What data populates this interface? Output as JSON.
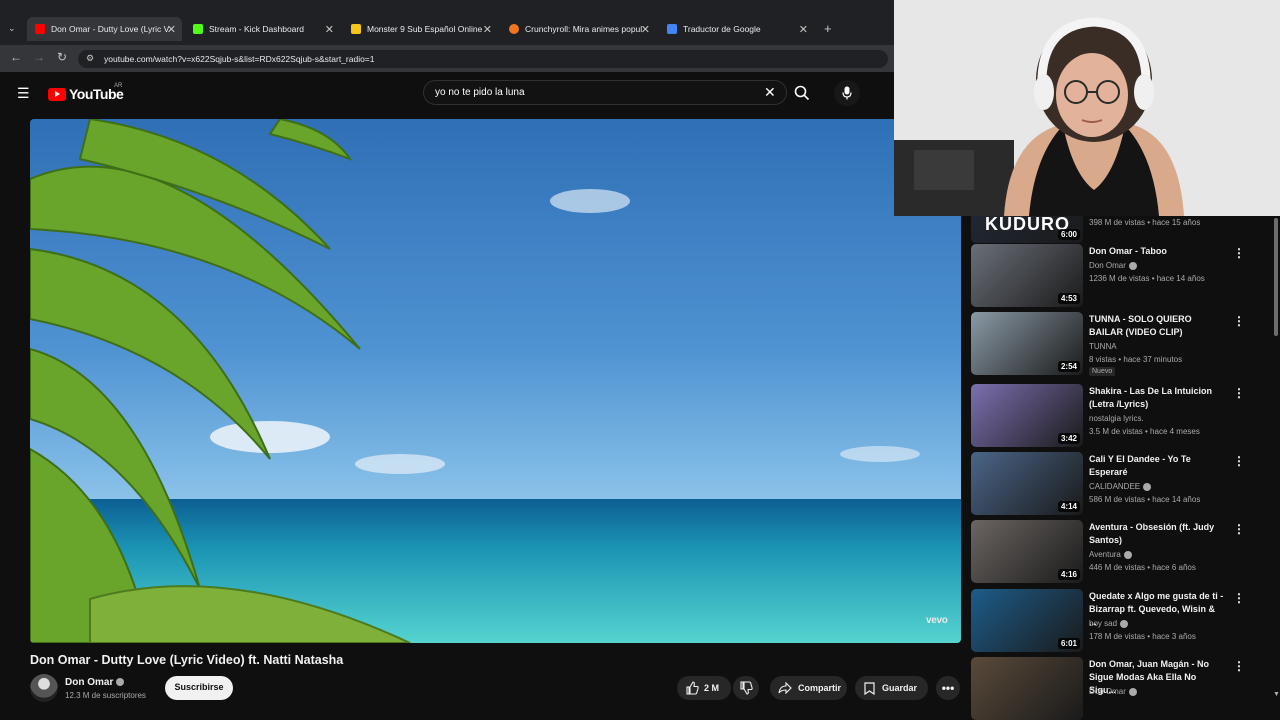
{
  "browser": {
    "tabs": [
      {
        "title": "Don Omar - Dutty Love (Lyric V",
        "favicon_color": "#ff0000",
        "active": true
      },
      {
        "title": "Stream - Kick Dashboard",
        "favicon_color": "#53fc18",
        "active": false
      },
      {
        "title": "Monster 9 Sub Español Online",
        "favicon_color": "#f5c518",
        "active": false
      },
      {
        "title": "Crunchyroll: Mira animes popul",
        "favicon_color": "#f47521",
        "active": false
      },
      {
        "title": "Traductor de Google",
        "favicon_color": "#4285f4",
        "active": false
      }
    ],
    "url": "youtube.com/watch?v=x622Sqjub-s&list=RDx622Sqjub-s&start_radio=1"
  },
  "youtube": {
    "logo_text": "YouTube",
    "country_code": "AR",
    "search_query": "yo no te pido la luna"
  },
  "video": {
    "watermark": "vevo",
    "title": "Don Omar - Dutty Love (Lyric Video) ft. Natti Natasha",
    "channel": "Don Omar",
    "subscribers": "12.3 M de suscriptores",
    "subscribe_label": "Suscribirse",
    "likes": "2 M",
    "share_label": "Compartir",
    "save_label": "Guardar"
  },
  "recommendations": [
    {
      "title": "",
      "channel": "",
      "meta": "398 M de vistas • hace 15 años",
      "duration": "6:00",
      "thumb": "#222a3a",
      "thumb_text": "KUDURO"
    },
    {
      "title": "Don Omar - Taboo",
      "channel": "Don Omar",
      "meta": "1236 M de vistas • hace 14 años",
      "duration": "4:53",
      "thumb": "#6a6f78"
    },
    {
      "title": "TUNNA - SOLO QUIERO BAILAR (VIDEO CLIP)",
      "channel": "TUNNA",
      "meta": "8 vistas • hace 37 minutos",
      "badge": "Nuevo",
      "duration": "2:54",
      "thumb": "#8a9aa6"
    },
    {
      "title": "Shakira - Las De La Intuicion (Letra /Lyrics)",
      "channel": "nostalgia lyrics.",
      "meta": "3.5 M de vistas • hace 4 meses",
      "duration": "3:42",
      "thumb": "#7d6fb0"
    },
    {
      "title": "Cali Y El Dandee - Yo Te Esperaré",
      "channel": "CALIDANDEE",
      "meta": "586 M de vistas • hace 14 años",
      "duration": "4:14",
      "thumb": "#4a6588"
    },
    {
      "title": "Aventura - Obsesión (ft. Judy Santos)",
      "channel": "Aventura",
      "meta": "446 M de vistas • hace 6 años",
      "duration": "4:16",
      "thumb": "#6b6562"
    },
    {
      "title": "Quedate x Algo me gusta de ti - Bizarrap ft. Quevedo, Wisin & ...",
      "channel": "boy sad",
      "meta": "178 M de vistas • hace 3 años",
      "duration": "6:01",
      "thumb": "#1d5c8a"
    },
    {
      "title": "Don Omar, Juan Magán - No Sigue Modas Aka Ella No Sigu...",
      "channel": "Don Omar",
      "meta": "",
      "duration": "",
      "thumb": "#5a4a3a"
    }
  ]
}
